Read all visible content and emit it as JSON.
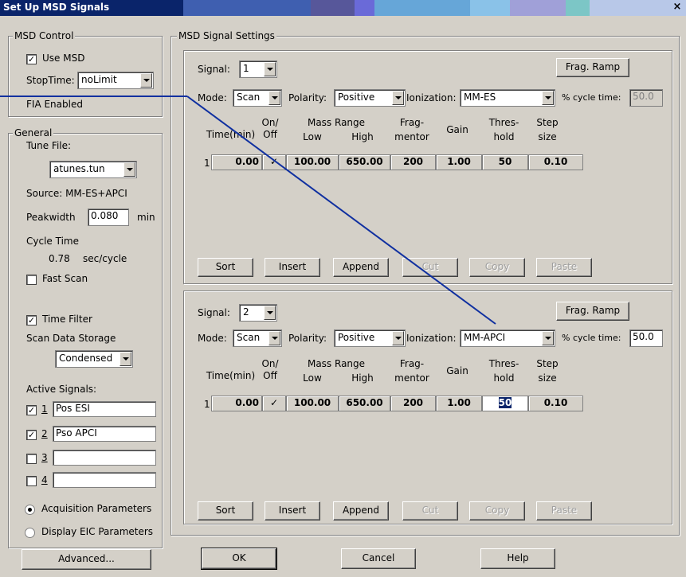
{
  "window": {
    "title": "Set Up MSD Signals",
    "close": "×",
    "colors": [
      "#0a246a",
      "#3f5fb0",
      "#57579a",
      "#6a6ad8",
      "#66a6d8",
      "#8ac2e8",
      "#a0a0d8",
      "#7cc6c6",
      "#b8c8e8"
    ]
  },
  "msd_control": {
    "legend": "MSD Control",
    "use_msd": "Use MSD",
    "use_msd_checked": true,
    "stoptime_label": "StopTime:",
    "stoptime_value": "noLimit",
    "fia": "FIA Enabled"
  },
  "general": {
    "legend": "General",
    "tune_file_label": "Tune File:",
    "tune_file_value": "atunes.tun",
    "source": "Source:  MM-ES+APCI",
    "peakwidth_label": "Peakwidth",
    "peakwidth_value": "0.080",
    "peakwidth_unit": "min",
    "cycle_time_label": "Cycle Time",
    "cycle_time_value": "0.78",
    "cycle_time_unit": "sec/cycle",
    "fast_scan": "Fast Scan",
    "time_filter": "Time Filter",
    "scan_data_storage": "Scan Data Storage",
    "storage_value": "Condensed",
    "active_signals": "Active Signals:",
    "signals": [
      {
        "num": "1",
        "name": "Pos ESI",
        "checked": true
      },
      {
        "num": "2",
        "name": "Pso APCI",
        "checked": true
      },
      {
        "num": "3",
        "name": "",
        "checked": false
      },
      {
        "num": "4",
        "name": "",
        "checked": false
      }
    ],
    "acq_params": "Acquisition Parameters",
    "eic_params": "Display EIC Parameters",
    "advanced": "Advanced..."
  },
  "signal_settings": {
    "legend": "MSD Signal Settings",
    "headers": {
      "time": "Time(min)",
      "onoff1": "On/",
      "onoff2": "Off",
      "mass_range": "Mass Range",
      "low": "Low",
      "high": "High",
      "frag1": "Frag-",
      "frag2": "mentor",
      "gain": "Gain",
      "thres1": "Thres-",
      "thres2": "hold",
      "step1": "Step",
      "step2": "size"
    },
    "panels": [
      {
        "signal_label": "Signal:",
        "signal_value": "1",
        "frag_ramp": "Frag. Ramp",
        "mode_label": "Mode:",
        "mode_value": "Scan",
        "polarity_label": "Polarity:",
        "polarity_value": "Positive",
        "ionization_label": "Ionization:",
        "ionization_value": "MM-ES",
        "cycle_label": "% cycle time:",
        "cycle_value": "50.0",
        "row": {
          "index": "1",
          "time": "0.00",
          "onoff": "✓",
          "low": "100.00",
          "high": "650.00",
          "frag": "200",
          "gain": "1.00",
          "thres": "50",
          "step": "0.10"
        },
        "buttons": {
          "sort": "Sort",
          "insert": "Insert",
          "append": "Append",
          "cut": "Cut",
          "copy": "Copy",
          "paste": "Paste"
        }
      },
      {
        "signal_label": "Signal:",
        "signal_value": "2",
        "frag_ramp": "Frag. Ramp",
        "mode_label": "Mode:",
        "mode_value": "Scan",
        "polarity_label": "Polarity:",
        "polarity_value": "Positive",
        "ionization_label": "Ionization:",
        "ionization_value": "MM-APCI",
        "cycle_label": "% cycle time:",
        "cycle_value": "50.0",
        "row": {
          "index": "1",
          "time": "0.00",
          "onoff": "✓",
          "low": "100.00",
          "high": "650.00",
          "frag": "200",
          "gain": "1.00",
          "thres": "50",
          "step": "0.10"
        },
        "buttons": {
          "sort": "Sort",
          "insert": "Insert",
          "append": "Append",
          "cut": "Cut",
          "copy": "Copy",
          "paste": "Paste"
        }
      }
    ]
  },
  "footer": {
    "ok": "OK",
    "cancel": "Cancel",
    "help": "Help"
  }
}
